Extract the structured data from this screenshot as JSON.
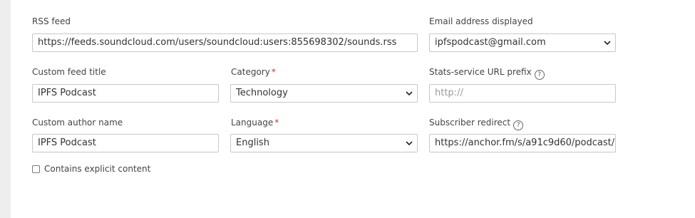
{
  "rss_feed": {
    "label": "RSS feed",
    "value": "https://feeds.soundcloud.com/users/soundcloud:users:855698302/sounds.rss"
  },
  "email_displayed": {
    "label": "Email address displayed",
    "value": "ipfspodcast@gmail.com"
  },
  "custom_feed_title": {
    "label": "Custom feed title",
    "value": "IPFS Podcast"
  },
  "category": {
    "label": "Category",
    "required_mark": "*",
    "value": "Technology"
  },
  "stats_prefix": {
    "label": "Stats-service URL prefix",
    "help": "?",
    "placeholder": "http://"
  },
  "custom_author": {
    "label": "Custom author name",
    "value": "IPFS Podcast"
  },
  "language": {
    "label": "Language",
    "required_mark": "*",
    "value": "English"
  },
  "subscriber_redirect": {
    "label": "Subscriber redirect",
    "help": "?",
    "value": "https://anchor.fm/s/a91c9d60/podcast/"
  },
  "explicit": {
    "label": "Contains explicit content",
    "checked": false
  }
}
